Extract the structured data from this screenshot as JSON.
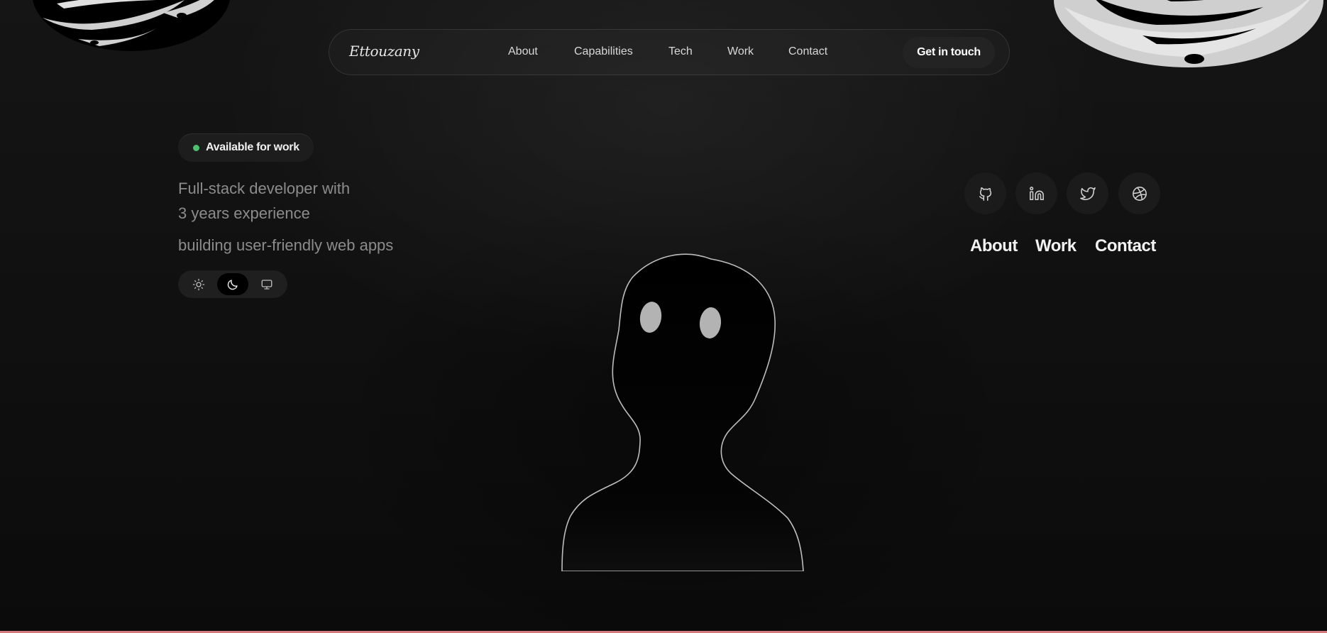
{
  "nav": {
    "logo": "Ettouzany",
    "links": [
      "About",
      "Capabilities",
      "Tech",
      "Work",
      "Contact"
    ],
    "cta": "Get in touch"
  },
  "hero": {
    "badge": "Available for work",
    "badge_color": "#4cc06c",
    "intro_lines": [
      "Full-stack developer with",
      "3 years experience",
      "building user-friendly web apps"
    ]
  },
  "theme_toggle": {
    "options": [
      "light-icon",
      "dark-icon",
      "system-icon"
    ],
    "selected": "dark"
  },
  "social": [
    "github-icon",
    "linkedin-icon",
    "twitter-icon",
    "dribbble-icon"
  ],
  "side_nav": [
    "About",
    "Work",
    "Contact"
  ],
  "accent_bottom": "#d77a7f"
}
